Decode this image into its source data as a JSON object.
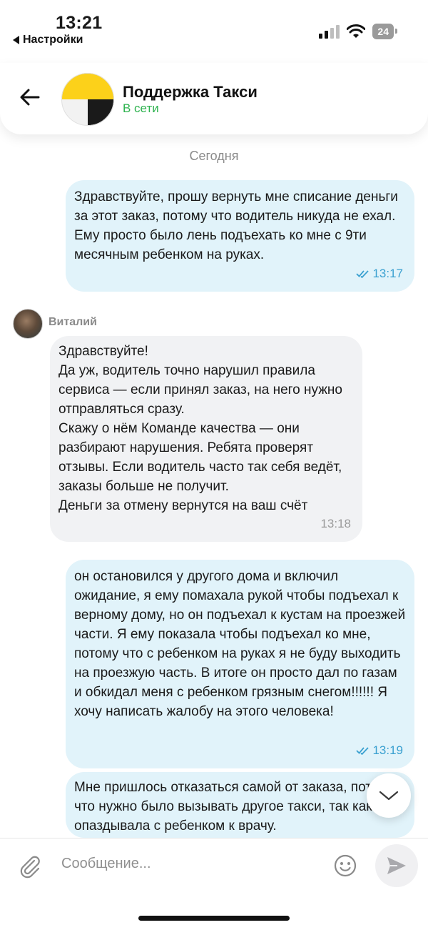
{
  "status_bar": {
    "time": "13:21",
    "back_label": "Настройки",
    "battery": "24"
  },
  "header": {
    "title": "Поддержка Такси",
    "status": "В сети",
    "status_color": "#2db24e",
    "logo_colors": [
      "#fcd11a",
      "#1a1a1a",
      "#f2f2f2"
    ]
  },
  "chat": {
    "day_label": "Сегодня",
    "messages": [
      {
        "direction": "outgoing",
        "text": "Здравствуйте, прошу вернуть мне списание деньги за этот заказ, потому что водитель никуда не ехал.\nЕму просто было лень подъехать ко мне с 9ти месячным ребенком на руках.",
        "time": "13:17",
        "read": true
      },
      {
        "direction": "incoming",
        "sender": "Виталий",
        "text": "Здравствуйте!\nДа уж, водитель точно нарушил правила сервиса — если принял заказ, на него нужно отправляться сразу.\nСкажу о нём Команде качества — они разбирают нарушения. Ребята проверят отзывы. Если водитель часто так себя ведёт, заказы больше не получит.\nДеньги за отмену вернутся на ваш счёт",
        "time": "13:18"
      },
      {
        "direction": "outgoing",
        "text": "он остановился у другого дома и включил ожидание, я ему помахала рукой чтобы подъехал к верному дому, но он подъехал к кустам на проезжей части. Я ему показала чтобы подъехал ко мне, потому что с ребенком на руках я не буду выходить на проезжую часть. В итоге он просто дал по газам и обкидал меня с ребенком грязным снегом!!!!!! Я хочу написать жалобу на этого человека!",
        "time": "13:19",
        "read": true
      },
      {
        "direction": "outgoing",
        "text": "Мне пришлось отказаться самой от заказа, потому что нужно было вызывать другое такси, так как опаздывала с ребенком к врачу."
      }
    ]
  },
  "composer": {
    "placeholder": "Сообщение..."
  },
  "colors": {
    "outgoing_bubble": "#e1f3fa",
    "incoming_bubble": "#f1f2f4",
    "read_check": "#3aa0d0"
  }
}
